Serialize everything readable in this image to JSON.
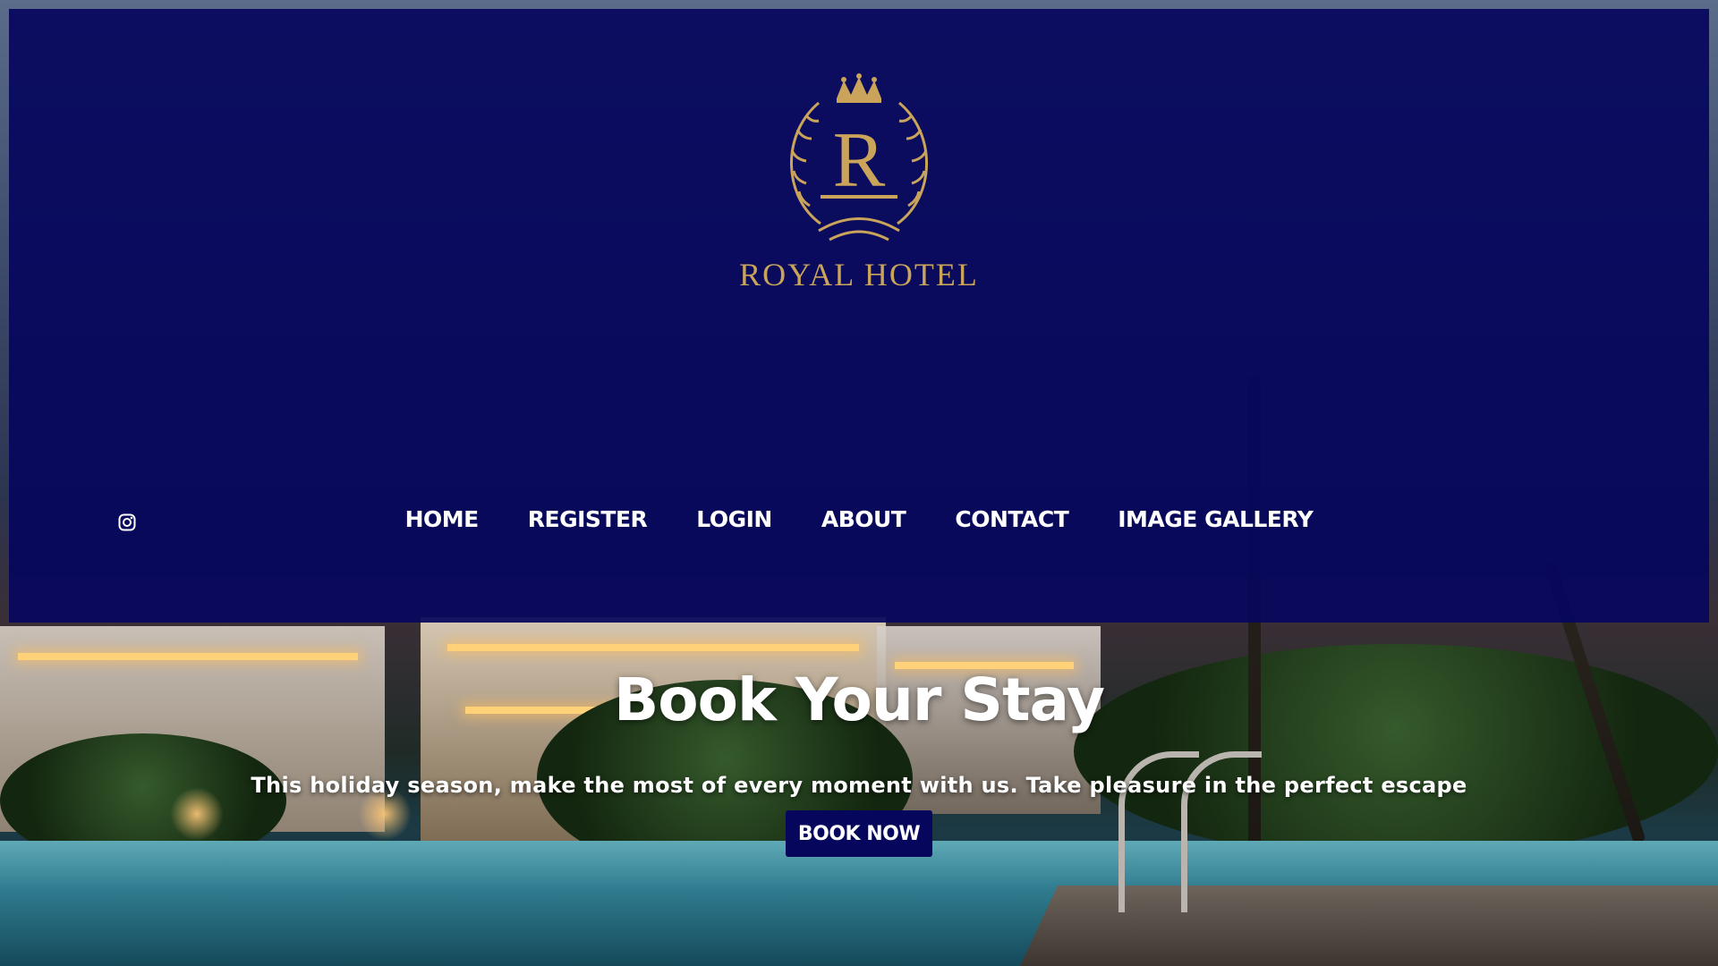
{
  "brand": {
    "name": "ROYAL HOTEL",
    "monogram": "R",
    "logo_icon": "crest-icon",
    "accent": "#c9a45a"
  },
  "header": {
    "background": "#06065c",
    "social": {
      "icon": "instagram-icon"
    }
  },
  "nav": {
    "items": [
      {
        "label": "HOME"
      },
      {
        "label": "REGISTER"
      },
      {
        "label": "LOGIN"
      },
      {
        "label": "ABOUT"
      },
      {
        "label": "CONTACT"
      },
      {
        "label": "IMAGE GALLERY"
      }
    ]
  },
  "hero": {
    "title": "Book Your Stay",
    "subtitle": "This holiday season, make the most of every moment with us. Take pleasure in the perfect escape",
    "cta_label": "BOOK NOW"
  }
}
